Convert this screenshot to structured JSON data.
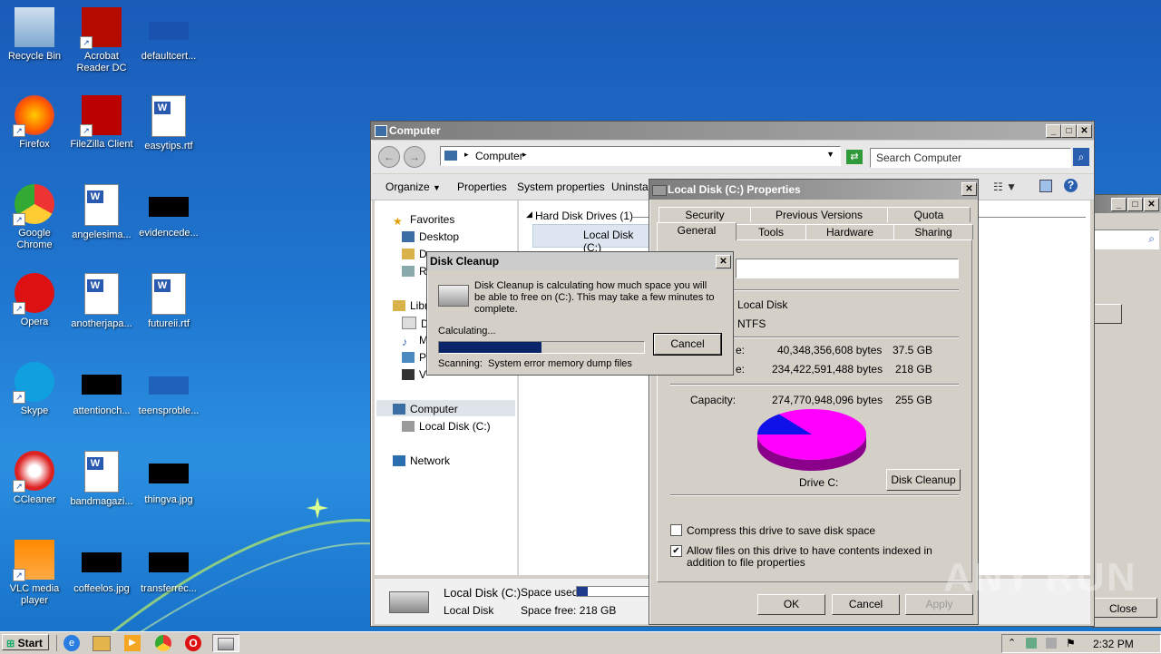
{
  "desktop": {
    "icons": [
      {
        "label": "Recycle Bin"
      },
      {
        "label": "Acrobat Reader DC"
      },
      {
        "label": "defaultcert..."
      },
      {
        "label": "Firefox"
      },
      {
        "label": "FileZilla Client"
      },
      {
        "label": "easytips.rtf"
      },
      {
        "label": "Google Chrome"
      },
      {
        "label": "angelesima..."
      },
      {
        "label": "evidencede..."
      },
      {
        "label": "Opera"
      },
      {
        "label": "anotherjapa..."
      },
      {
        "label": "futureii.rtf"
      },
      {
        "label": "Skype"
      },
      {
        "label": "attentionch..."
      },
      {
        "label": "teensproble..."
      },
      {
        "label": "CCleaner"
      },
      {
        "label": "bandmagazi..."
      },
      {
        "label": "thingva.jpg"
      },
      {
        "label": "VLC media player"
      },
      {
        "label": "coffeelos.jpg"
      },
      {
        "label": "transferrec..."
      }
    ]
  },
  "explorer": {
    "title": "Computer",
    "address": "Computer",
    "search_placeholder": "Search Computer",
    "toolbar": {
      "organize": "Organize",
      "properties": "Properties",
      "system_properties": "System properties",
      "uninstall": "Uninstall"
    },
    "nav": {
      "favorites": "Favorites",
      "desktop": "Desktop",
      "downloads": "Do",
      "recent": "R",
      "libraries": "Libr",
      "documents": "D",
      "music": "M",
      "pictures": "P",
      "videos": "V",
      "computer": "Computer",
      "local_disk": "Local Disk (C:)",
      "network": "Network"
    },
    "group_header": "Hard Disk Drives (1)",
    "drive_item": "Local Disk (C:)",
    "details": {
      "name": "Local Disk (C:)",
      "type": "Local Disk",
      "space_used_label": "Space used:",
      "space_free": "Space free: 218 GB"
    }
  },
  "properties": {
    "title": "Local Disk (C:) Properties",
    "tabs_back": [
      "Security",
      "Previous Versions",
      "Quota"
    ],
    "tabs_front": [
      "General",
      "Tools",
      "Hardware",
      "Sharing"
    ],
    "type_value": "Local Disk",
    "fs_value": "NTFS",
    "used_suffix": "e:",
    "used_bytes": "40,348,356,608 bytes",
    "used_gb": "37.5 GB",
    "free_suffix": "e:",
    "free_bytes": "234,422,591,488 bytes",
    "free_gb": "218 GB",
    "capacity_label": "Capacity:",
    "capacity_bytes": "274,770,948,096 bytes",
    "capacity_gb": "255 GB",
    "drive_label": "Drive C:",
    "disk_cleanup_button": "Disk Cleanup",
    "compress_label": "Compress this drive to save disk space",
    "index_label": "Allow files on this drive to have contents indexed in addition to file properties",
    "ok": "OK",
    "cancel": "Cancel",
    "apply": "Apply",
    "used_fraction": 0.147,
    "colors": {
      "used": "#1010e8",
      "free": "#ff00ff"
    }
  },
  "cleanup": {
    "title": "Disk Cleanup",
    "message": "Disk Cleanup is calculating how much space you will be able to free on  (C:). This may take a few minutes to complete.",
    "calculating": "Calculating...",
    "cancel": "Cancel",
    "scanning_label": "Scanning:",
    "scanning_item": "System error memory dump files",
    "progress": 0.5
  },
  "bgwindow": {
    "close_label": "Close"
  },
  "taskbar": {
    "start": "Start",
    "clock": "2:32 PM"
  },
  "watermark": "ANY RUN"
}
